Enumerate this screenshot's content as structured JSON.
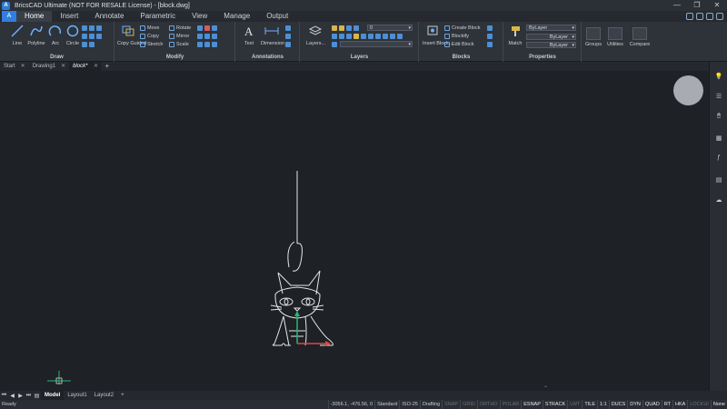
{
  "window": {
    "title": "BricsCAD Ultimate (NOT FOR RESALE License) - [block.dwg]",
    "app_icon": "A",
    "controls": [
      "—",
      "❐",
      "✕"
    ]
  },
  "menu": {
    "logo": "A",
    "tabs": [
      "Home",
      "Insert",
      "Annotate",
      "Parametric",
      "View",
      "Manage",
      "Output"
    ],
    "active_tab": "Home"
  },
  "ribbon": {
    "draw": {
      "label": "Draw",
      "tools": [
        "Line",
        "Polyline",
        "Arc",
        "Circle"
      ]
    },
    "modify": {
      "label": "Modify",
      "copy_guided": "Copy Guided",
      "move": "Move",
      "copy": "Copy",
      "stretch": "Stretch",
      "rotate": "Rotate",
      "mirror": "Mirror",
      "scale": "Scale"
    },
    "annotations": {
      "label": "Annotations",
      "text": "Text",
      "dimension": "Dimension"
    },
    "layers": {
      "label": "Layers",
      "layers_button": "Layers...",
      "current_layer": "0"
    },
    "blocks": {
      "label": "Blocks",
      "insert": "Insert Block...",
      "create": "Create Block",
      "blockify": "Blockify",
      "edit": "Edit Block"
    },
    "properties": {
      "label": "Properties",
      "match": "Match",
      "color": "ByLayer",
      "linetype": "ByLayer",
      "lineweight": "ByLayer"
    },
    "groups": "Groups",
    "utilities": "Utilities",
    "compare": "Compare"
  },
  "doc_tabs": [
    {
      "label": "Start",
      "active": false
    },
    {
      "label": "Drawing1",
      "active": false
    },
    {
      "label": "block*",
      "active": true
    }
  ],
  "layout_tabs": [
    "Model",
    "Layout1",
    "Layout2"
  ],
  "status": {
    "ready": "Ready",
    "coords": "-3056.1, -476.56, 0",
    "text_style": "Standard",
    "dim_style": "ISO-25",
    "workspace": "Drafting",
    "toggles": [
      {
        "label": "SNAP",
        "on": false
      },
      {
        "label": "GRID",
        "on": false
      },
      {
        "label": "ORTHO",
        "on": false
      },
      {
        "label": "POLAR",
        "on": false
      },
      {
        "label": "ESNAP",
        "on": true
      },
      {
        "label": "STRACK",
        "on": true
      },
      {
        "label": "LWT",
        "on": false
      },
      {
        "label": "TILE",
        "on": true
      },
      {
        "label": "1:1",
        "on": true
      },
      {
        "label": "DUCS",
        "on": true
      },
      {
        "label": "DYN",
        "on": true
      },
      {
        "label": "QUAD",
        "on": true
      },
      {
        "label": "RT",
        "on": true
      },
      {
        "label": "HKA",
        "on": true
      },
      {
        "label": "LOCKUI",
        "on": false
      },
      {
        "label": "None",
        "on": true
      }
    ]
  },
  "colors": {
    "accent": "#2f7fe0",
    "canvas": "#1e2126",
    "drawing_stroke": "#e6e6e6",
    "ucs_y": "#2bb673",
    "ucs_x": "#e04545"
  }
}
